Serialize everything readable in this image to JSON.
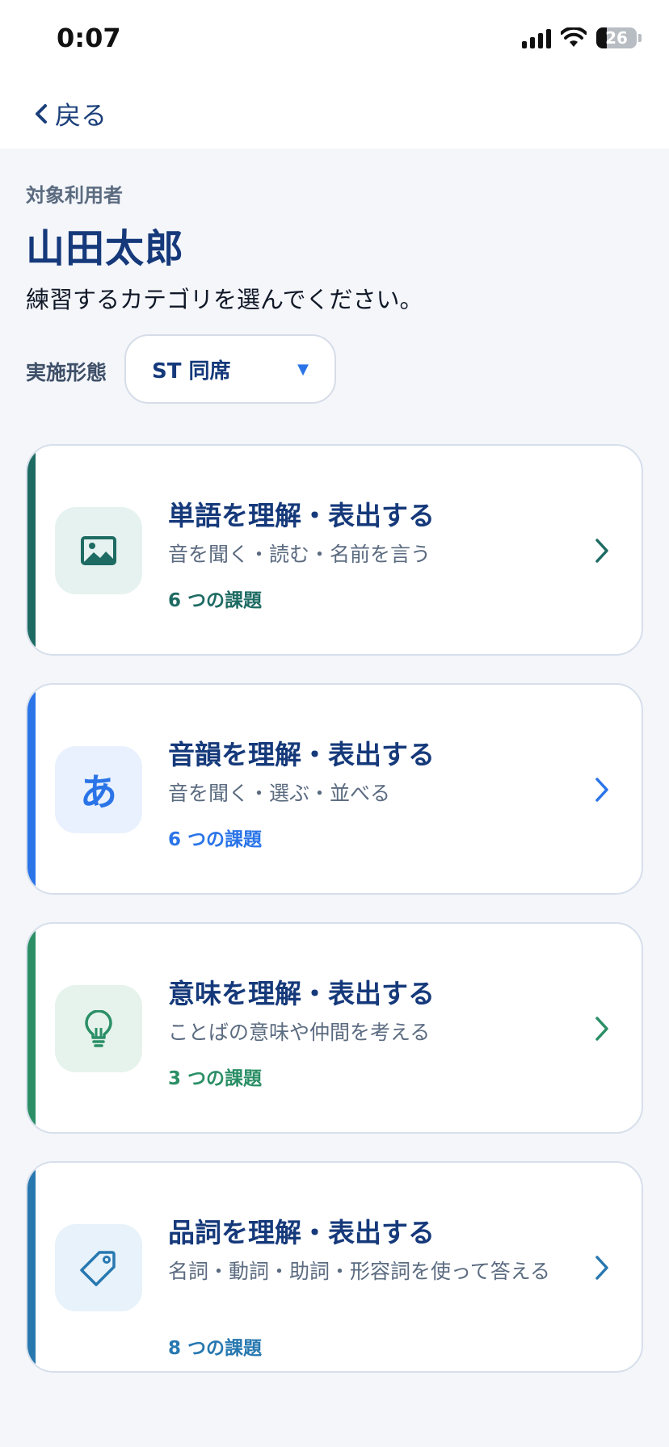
{
  "status_bar": {
    "time": "0:07",
    "battery": "26",
    "battery_level": 0.26
  },
  "nav": {
    "back_label": "戻る"
  },
  "header": {
    "target_label": "対象利用者",
    "user_name": "山田太郎",
    "instruction": "練習するカテゴリを選んでください。"
  },
  "mode": {
    "label": "実施形態",
    "value": "ST 同席"
  },
  "categories": [
    {
      "title": "単語を理解・表出する",
      "subtitle": "音を聞く・読む・名前を言う",
      "count": "6 つの課題",
      "icon": "image-icon",
      "accent": "#1e6b63",
      "icon_bg": "#e6f2f0"
    },
    {
      "title": "音韻を理解・表出する",
      "subtitle": "音を聞く・選ぶ・並べる",
      "count": "6 つの課題",
      "icon_glyph": "あ",
      "accent": "#2a74e8",
      "icon_bg": "#e8f1fd"
    },
    {
      "title": "意味を理解・表出する",
      "subtitle": "ことばの意味や仲間を考える",
      "count": "3 つの課題",
      "icon": "lightbulb-icon",
      "accent": "#2b8f66",
      "icon_bg": "#e5f3ec"
    },
    {
      "title": "品詞を理解・表出する",
      "subtitle": "名詞・動詞・助詞・形容詞を使って答える",
      "count": "8 つの課題",
      "icon": "tag-icon",
      "accent": "#2878b0",
      "icon_bg": "#e7f2fa"
    }
  ]
}
